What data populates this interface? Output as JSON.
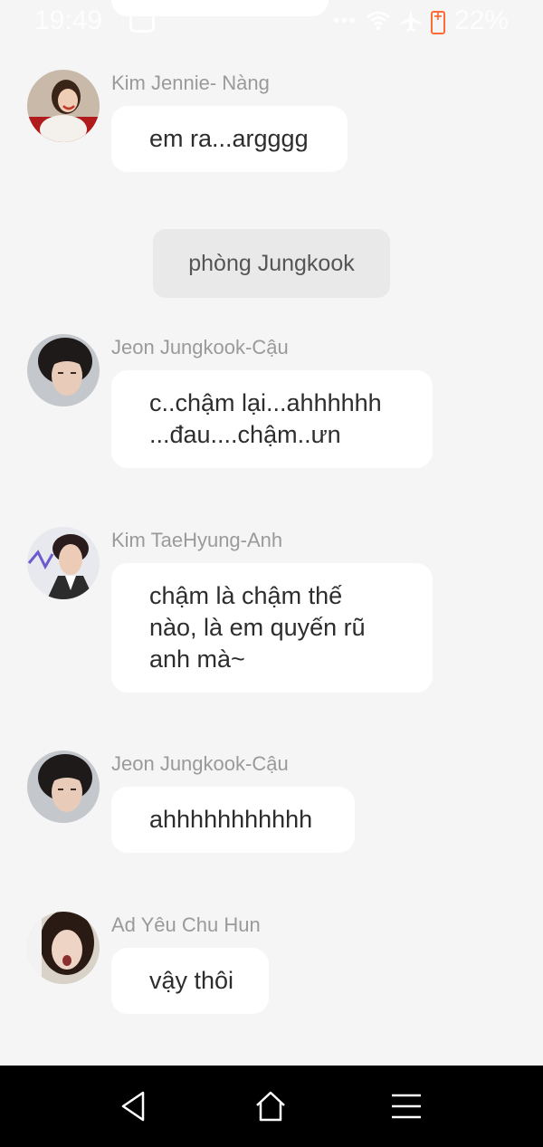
{
  "status_bar": {
    "time": "19:49",
    "battery": "22%",
    "dots": "•••"
  },
  "system_label": "phòng Jungkook",
  "messages": [
    {
      "sender": "Kim Jennie- Nàng",
      "text": "em ra...argggg"
    },
    {
      "sender": "Jeon Jungkook-Cậu",
      "lines": [
        "c..chậm lại...ahhhhhh",
        "...đau....chậm..ưn"
      ]
    },
    {
      "sender": "Kim TaeHyung-Anh",
      "lines": [
        "chậm là chậm thế",
        "nào, là em quyến rũ",
        "anh mà~"
      ]
    },
    {
      "sender": "Jeon Jungkook-Cậu",
      "text": "ahhhhhhhhhhh"
    },
    {
      "sender": "Ad Yêu Chu Hun",
      "text": "vậy thôi"
    }
  ],
  "nav": {
    "back_icon": "back-triangle-icon",
    "home_icon": "home-icon",
    "menu_icon": "menu-lines-icon"
  },
  "colors": {
    "background": "#f5f5f5",
    "bubble": "#ffffff",
    "sender": "#9a9a9a",
    "battery": "#ff6b35",
    "nav_bar": "#000000"
  }
}
